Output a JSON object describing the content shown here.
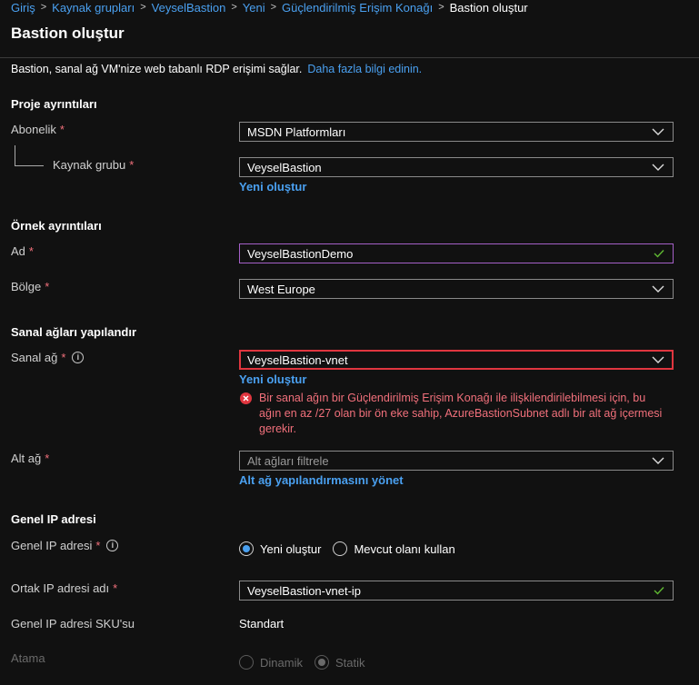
{
  "breadcrumb": {
    "items": [
      "Giriş",
      "Kaynak grupları",
      "VeyselBastion",
      "Yeni",
      "Güçlendirilmiş Erişim Konağı"
    ],
    "current": "Bastion oluştur"
  },
  "page": {
    "title": "Bastion oluştur",
    "intro": "Bastion, sanal ağ VM'nize web tabanlı RDP erişimi sağlar.",
    "intro_link": "Daha fazla bilgi edinin."
  },
  "project": {
    "heading": "Proje ayrıntıları",
    "subscription_label": "Abonelik",
    "subscription_value": "MSDN Platformları",
    "resource_group_label": "Kaynak grubu",
    "resource_group_value": "VeyselBastion",
    "create_new": "Yeni oluştur"
  },
  "instance": {
    "heading": "Örnek ayrıntıları",
    "name_label": "Ad",
    "name_value": "VeyselBastionDemo",
    "region_label": "Bölge",
    "region_value": "West Europe"
  },
  "vnet": {
    "heading": "Sanal ağları yapılandır",
    "vnet_label": "Sanal ağ",
    "vnet_value": "VeyselBastion-vnet",
    "create_new": "Yeni oluştur",
    "error_line1": "Bir sanal ağın bir Güçlendirilmiş Erişim Konağı ile ilişkilendirilebilmesi için, bu",
    "error_line2": "ağın en az /27 olan bir ön eke sahip, AzureBastionSubnet adlı bir alt ağ içermesi",
    "error_line3": "gerekir.",
    "subnet_label": "Alt ağ",
    "subnet_placeholder": "Alt ağları filtrele",
    "manage_subnet": "Alt ağ yapılandırmasını yönet"
  },
  "public_ip": {
    "heading": "Genel IP adresi",
    "ip_label": "Genel IP adresi",
    "option_new": "Yeni oluştur",
    "option_existing": "Mevcut olanı kullan",
    "name_label": "Ortak IP adresi adı",
    "name_value": "VeyselBastion-vnet-ip",
    "sku_label": "Genel IP adresi SKU'su",
    "sku_value": "Standart",
    "assignment_label": "Atama",
    "option_dynamic": "Dinamik",
    "option_static": "Statik"
  },
  "required_marker": "*",
  "colors": {
    "background": "#111111",
    "link": "#4aa0f0",
    "required": "#f1707b",
    "error_border": "#e0363f",
    "focus_border": "#a560c8",
    "valid_check": "#5fb832"
  },
  "icons": [
    "chevron-down-icon",
    "checkmark-icon",
    "info-icon",
    "error-icon"
  ]
}
